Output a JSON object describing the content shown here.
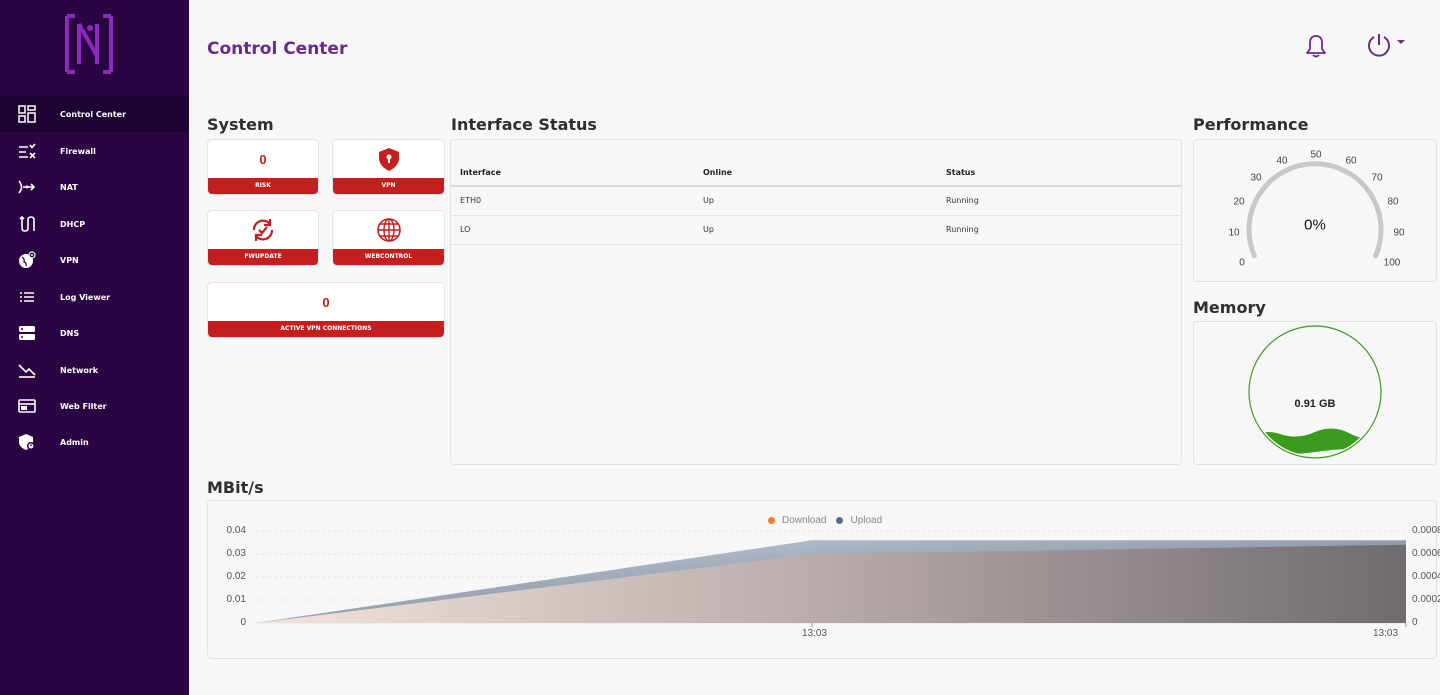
{
  "app": {
    "title": "Control Center"
  },
  "sidebar": {
    "items": [
      {
        "label": "Control Center",
        "icon": "dashboard-icon",
        "active": true
      },
      {
        "label": "Firewall",
        "icon": "firewall-icon"
      },
      {
        "label": "NAT",
        "icon": "nat-icon"
      },
      {
        "label": "DHCP",
        "icon": "dhcp-icon"
      },
      {
        "label": "VPN",
        "icon": "vpn-globe-icon"
      },
      {
        "label": "Log Viewer",
        "icon": "list-icon"
      },
      {
        "label": "DNS",
        "icon": "server-icon"
      },
      {
        "label": "Network",
        "icon": "network-icon"
      },
      {
        "label": "Web Filter",
        "icon": "web-filter-icon"
      },
      {
        "label": "Admin",
        "icon": "admin-shield-icon"
      }
    ]
  },
  "system": {
    "title": "System",
    "risk": {
      "value": "0",
      "label": "RISK"
    },
    "vpn": {
      "label": "VPN"
    },
    "fwupdate": {
      "label": "FWUPDATE"
    },
    "webcontrol": {
      "label": "WEBCONTROL"
    },
    "active_vpn": {
      "value": "0",
      "label": "ACTIVE VPN CONNECTIONS"
    }
  },
  "interface_status": {
    "title": "Interface Status",
    "columns": [
      "Interface",
      "Online",
      "Status"
    ],
    "rows": [
      [
        "ETH0",
        "Up",
        "Running"
      ],
      [
        "LO",
        "Up",
        "Running"
      ]
    ]
  },
  "performance": {
    "title": "Performance",
    "value": "0%",
    "ticks": [
      "0",
      "10",
      "20",
      "30",
      "40",
      "50",
      "60",
      "70",
      "80",
      "90",
      "100"
    ]
  },
  "memory": {
    "title": "Memory",
    "value": "0.91 GB",
    "color": "#3a9b1f"
  },
  "chart": {
    "title": "MBit/s"
  },
  "chart_data": {
    "type": "area",
    "x": [
      "",
      "13:03",
      "13:03"
    ],
    "series": [
      {
        "name": "Download",
        "color": "#ef7d2d",
        "values": [
          0,
          0.03,
          0.034
        ]
      },
      {
        "name": "Upload",
        "color": "#5d6b80",
        "values": [
          0,
          0.036,
          0.036
        ]
      }
    ],
    "left_axis": {
      "ticks": [
        "0",
        "0.01",
        "0.02",
        "0.03",
        "0.04"
      ],
      "ylim": [
        0,
        0.04
      ]
    },
    "right_axis": {
      "ticks": [
        "0",
        "0.0002",
        "0.0004",
        "0.0006",
        "0.0008"
      ]
    },
    "legend": "top-center"
  }
}
